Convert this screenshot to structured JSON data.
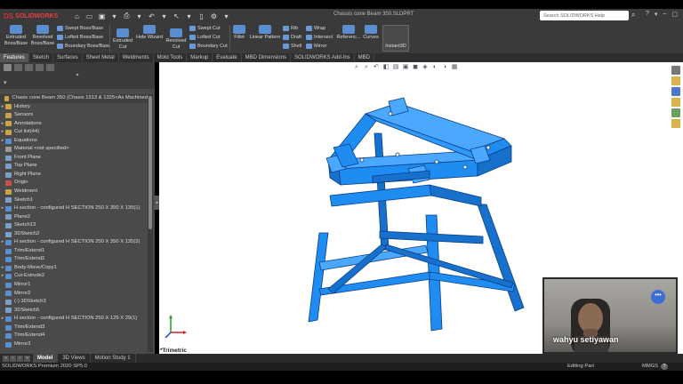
{
  "app": {
    "brand": "SOLIDWORKS",
    "brand_prefix": "DS",
    "document_title": "Chassis cone Beam 350.SLDPRT",
    "search_placeholder": "Search SOLIDWORKS Help"
  },
  "quick_access": [
    "⌂",
    "▭",
    "▣",
    "▾",
    "⎙",
    "▾",
    "↶",
    "▾",
    "↖",
    "▾",
    "▯",
    "⚙",
    "▾"
  ],
  "window_controls": [
    "?",
    "▾",
    "–",
    "▢",
    "✕"
  ],
  "commands": {
    "extruded_boss": "Extruded Boss/Base",
    "revolved_boss": "Revolved Boss/Base",
    "swept_boss": "Swept Boss/Base",
    "lofted_boss": "Lofted Boss/Base",
    "boundary_boss": "Boundary Boss/Base",
    "extruded_cut": "Extruded Cut",
    "hole_wizard": "Hole Wizard",
    "revolved_cut": "Revolved Cut",
    "swept_cut": "Swept Cut",
    "lofted_cut": "Lofted Cut",
    "boundary_cut": "Boundary Cut",
    "fillet": "Fillet",
    "linear_pattern": "Linear Pattern",
    "rib": "Rib",
    "draft": "Draft",
    "shell": "Shell",
    "wrap": "Wrap",
    "intersect": "Intersect",
    "mirror": "Mirror",
    "reference": "Referenc...",
    "curves": "Curves",
    "instant3d": "Instant3D"
  },
  "tabs": [
    "Features",
    "Sketch",
    "Surfaces",
    "Sheet Metal",
    "Weldments",
    "Mold Tools",
    "Markup",
    "Evaluate",
    "MBD Dimensions",
    "SOLIDWORKS Add-Ins",
    "MBD"
  ],
  "active_tab": "Features",
  "tree": {
    "root": "Chasis cone Beam 350  (Chasis 1313 & 1325<As Machined",
    "items": [
      {
        "label": "History",
        "arrow": "▸",
        "color": "#c9a24a"
      },
      {
        "label": "Sensors",
        "arrow": "",
        "color": "#c9a24a"
      },
      {
        "label": "Annotations",
        "arrow": "▸",
        "color": "#c9a24a"
      },
      {
        "label": "Cut list(44)",
        "arrow": "▸",
        "color": "#c9a24a"
      },
      {
        "label": "Equations",
        "arrow": "▸",
        "color": "#5b8ed0"
      },
      {
        "label": "Material <not specified>",
        "arrow": "",
        "color": "#9a9a9a"
      },
      {
        "label": "Front Plane",
        "arrow": "",
        "color": "#7aa0c8"
      },
      {
        "label": "Top Plane",
        "arrow": "",
        "color": "#7aa0c8"
      },
      {
        "label": "Right Plane",
        "arrow": "",
        "color": "#7aa0c8"
      },
      {
        "label": "Origin",
        "arrow": "",
        "color": "#c85050"
      },
      {
        "label": "Weldment",
        "arrow": "",
        "color": "#c9a24a"
      },
      {
        "label": "Sketch1",
        "arrow": "",
        "color": "#7aa0c8"
      },
      {
        "label": "H section - configured H SECTION 250 X 350 X 135(1)",
        "arrow": "▸",
        "color": "#5b8ed0"
      },
      {
        "label": "Plane2",
        "arrow": "",
        "color": "#7aa0c8"
      },
      {
        "label": "Sketch13",
        "arrow": "",
        "color": "#7aa0c8"
      },
      {
        "label": "3DSketch2",
        "arrow": "",
        "color": "#7aa0c8"
      },
      {
        "label": "H section - configured H SECTION 250 X 350 X 135(2)",
        "arrow": "▸",
        "color": "#5b8ed0"
      },
      {
        "label": "Trim/Extend1",
        "arrow": "",
        "color": "#5b8ed0"
      },
      {
        "label": "Trim/Extend2",
        "arrow": "",
        "color": "#5b8ed0"
      },
      {
        "label": "Body-Move/Copy1",
        "arrow": "▸",
        "color": "#5b8ed0"
      },
      {
        "label": "Cut-Extrude2",
        "arrow": "▸",
        "color": "#5b8ed0"
      },
      {
        "label": "Mirror1",
        "arrow": "",
        "color": "#5b8ed0"
      },
      {
        "label": "Mirror2",
        "arrow": "",
        "color": "#5b8ed0"
      },
      {
        "label": "(-) 3DSketch3",
        "arrow": "",
        "color": "#7aa0c8"
      },
      {
        "label": "3DSketch5",
        "arrow": "",
        "color": "#7aa0c8"
      },
      {
        "label": "H section - configured H SECTION 250 X 125 X 29(1)",
        "arrow": "▸",
        "color": "#5b8ed0"
      },
      {
        "label": "Trim/Extend3",
        "arrow": "",
        "color": "#5b8ed0"
      },
      {
        "label": "Trim/Extend4",
        "arrow": "",
        "color": "#5b8ed0"
      },
      {
        "label": "Mirror3",
        "arrow": "",
        "color": "#5b8ed0"
      }
    ]
  },
  "viewport": {
    "view_name": "*Trimetric",
    "model_color": "#1e8cf0",
    "model_edge_color": "#0b3f86"
  },
  "webcam": {
    "name": "wahyu setiyawan",
    "more": "•••"
  },
  "model_tabs": [
    "Model",
    "3D Views",
    "Motion Study 1"
  ],
  "active_model_tab": "Model",
  "status": {
    "product": "SOLIDWORKS Premium 2020 SP5.0",
    "mode": "Editing Part",
    "units": "MMGS",
    "help": "?"
  }
}
